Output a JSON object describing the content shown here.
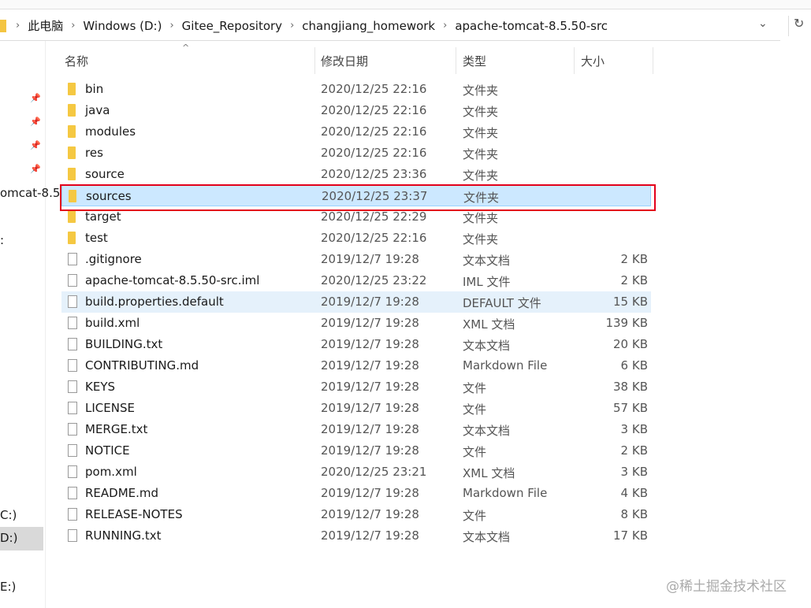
{
  "breadcrumb": [
    "此电脑",
    "Windows (D:)",
    "Gitee_Repository",
    "changjiang_homework",
    "apache-tomcat-8.5.50-src"
  ],
  "sidebar": {
    "items": [
      "omcat-8.5",
      ":",
      "C:)",
      "D:)",
      "E:)"
    ]
  },
  "columns": {
    "name": "名称",
    "date": "修改日期",
    "type": "类型",
    "size": "大小"
  },
  "files": [
    {
      "name": "bin",
      "date": "2020/12/25 22:16",
      "type": "文件夹",
      "size": "",
      "kind": "folder"
    },
    {
      "name": "java",
      "date": "2020/12/25 22:16",
      "type": "文件夹",
      "size": "",
      "kind": "folder"
    },
    {
      "name": "modules",
      "date": "2020/12/25 22:16",
      "type": "文件夹",
      "size": "",
      "kind": "folder"
    },
    {
      "name": "res",
      "date": "2020/12/25 22:16",
      "type": "文件夹",
      "size": "",
      "kind": "folder"
    },
    {
      "name": "source",
      "date": "2020/12/25 23:36",
      "type": "文件夹",
      "size": "",
      "kind": "folder"
    },
    {
      "name": "sources",
      "date": "2020/12/25 23:37",
      "type": "文件夹",
      "size": "",
      "kind": "folder"
    },
    {
      "name": "target",
      "date": "2020/12/25 22:29",
      "type": "文件夹",
      "size": "",
      "kind": "folder"
    },
    {
      "name": "test",
      "date": "2020/12/25 22:16",
      "type": "文件夹",
      "size": "",
      "kind": "folder"
    },
    {
      "name": ".gitignore",
      "date": "2019/12/7 19:28",
      "type": "文本文档",
      "size": "2 KB",
      "kind": "file"
    },
    {
      "name": "apache-tomcat-8.5.50-src.iml",
      "date": "2020/12/25 23:22",
      "type": "IML 文件",
      "size": "2 KB",
      "kind": "file"
    },
    {
      "name": "build.properties.default",
      "date": "2019/12/7 19:28",
      "type": "DEFAULT 文件",
      "size": "15 KB",
      "kind": "file"
    },
    {
      "name": "build.xml",
      "date": "2019/12/7 19:28",
      "type": "XML 文档",
      "size": "139 KB",
      "kind": "file"
    },
    {
      "name": "BUILDING.txt",
      "date": "2019/12/7 19:28",
      "type": "文本文档",
      "size": "20 KB",
      "kind": "file"
    },
    {
      "name": "CONTRIBUTING.md",
      "date": "2019/12/7 19:28",
      "type": "Markdown File",
      "size": "6 KB",
      "kind": "file"
    },
    {
      "name": "KEYS",
      "date": "2019/12/7 19:28",
      "type": "文件",
      "size": "38 KB",
      "kind": "file"
    },
    {
      "name": "LICENSE",
      "date": "2019/12/7 19:28",
      "type": "文件",
      "size": "57 KB",
      "kind": "file"
    },
    {
      "name": "MERGE.txt",
      "date": "2019/12/7 19:28",
      "type": "文本文档",
      "size": "3 KB",
      "kind": "file"
    },
    {
      "name": "NOTICE",
      "date": "2019/12/7 19:28",
      "type": "文件",
      "size": "2 KB",
      "kind": "file"
    },
    {
      "name": "pom.xml",
      "date": "2020/12/25 23:21",
      "type": "XML 文档",
      "size": "3 KB",
      "kind": "file"
    },
    {
      "name": "README.md",
      "date": "2019/12/7 19:28",
      "type": "Markdown File",
      "size": "4 KB",
      "kind": "file"
    },
    {
      "name": "RELEASE-NOTES",
      "date": "2019/12/7 19:28",
      "type": "文件",
      "size": "8 KB",
      "kind": "file"
    },
    {
      "name": "RUNNING.txt",
      "date": "2019/12/7 19:28",
      "type": "文本文档",
      "size": "17 KB",
      "kind": "file"
    }
  ],
  "watermark": "@稀土掘金技术社区"
}
